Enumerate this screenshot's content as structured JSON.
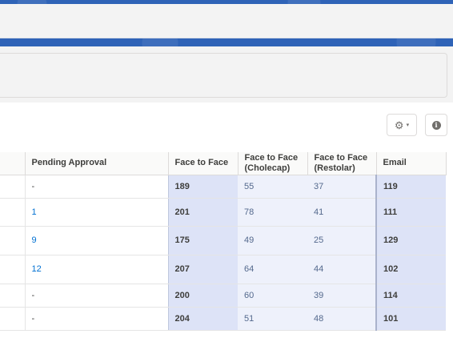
{
  "table": {
    "headers": [
      "",
      "Pending Approval",
      "Face to Face",
      "Face to Face (Cholecap)",
      "Face to Face (Restolar)",
      "Email"
    ],
    "header_lines": {
      "cholecap": [
        "Face to Face",
        "(Cholecap)"
      ],
      "restolar": [
        "Face to Face",
        "(Restolar)"
      ]
    },
    "rows": [
      {
        "pending": "-",
        "f2f": "189",
        "cholecap": "55",
        "restolar": "37",
        "email": "119"
      },
      {
        "pending": "1",
        "f2f": "201",
        "cholecap": "78",
        "restolar": "41",
        "email": "111"
      },
      {
        "pending": "9",
        "f2f": "175",
        "cholecap": "49",
        "restolar": "25",
        "email": "129"
      },
      {
        "pending": "12",
        "f2f": "207",
        "cholecap": "64",
        "restolar": "44",
        "email": "102"
      },
      {
        "pending": "-",
        "f2f": "200",
        "cholecap": "60",
        "restolar": "39",
        "email": "114"
      },
      {
        "pending": "-",
        "f2f": "204",
        "cholecap": "51",
        "restolar": "48",
        "email": "101"
      }
    ]
  },
  "toolbar": {
    "settings_icon": "gear-icon",
    "settings_caret": "▾",
    "info_icon": "info-icon",
    "info_glyph": "i"
  },
  "colors": {
    "banner": "#2f63b7",
    "face_to_face_bg": "#dde3f7",
    "product_bg": "#eef1fb",
    "link": "#0070d2"
  }
}
